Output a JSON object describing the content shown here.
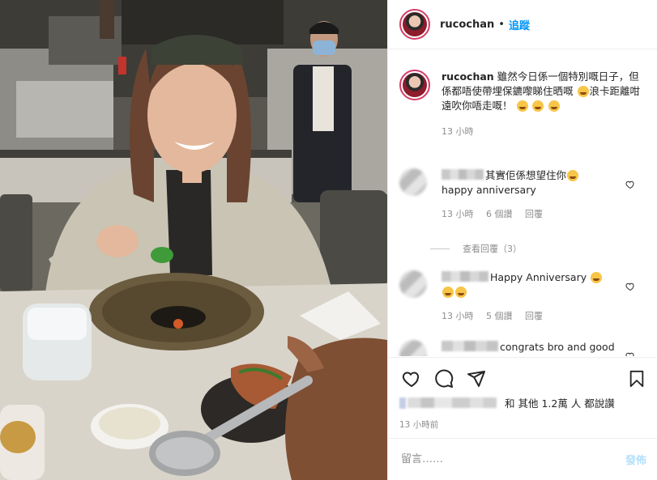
{
  "post": {
    "username": "rucochan",
    "follow_label": "追蹤",
    "separator": "•",
    "caption": {
      "username": "rucochan",
      "text": "雖然今日係一個特別嘅日子，但係都唔使帶埋保鑣嚟睇住晒嘅",
      "text_after_emoji": "浪卡距離咁遠吹你唔走嘅！",
      "time": "13 小時",
      "emoji": [
        "grinning-sweat-emoji",
        "rolling-laugh-emoji",
        "rolling-laugh-emoji",
        "rolling-laugh-emoji"
      ]
    },
    "comments": [
      {
        "text": "其實佢係想望住你",
        "line2": "happy anniversary",
        "time": "13 小時",
        "likes": "6 個讚",
        "reply": "回覆",
        "view_replies": "查看回覆（3）"
      },
      {
        "text": "Happy Anniversary",
        "time": "13 小時",
        "likes": "5 個讚",
        "reply": "回覆"
      },
      {
        "text": "congrats bro and good"
      }
    ],
    "likes_text": "和 其他 1.2萬 人 都說讚",
    "posted_ago": "13 小時前",
    "comment_placeholder": "留言……",
    "post_label": "發佈"
  },
  "icons": {
    "like": "heart-icon",
    "comment": "comment-bubble-icon",
    "share": "paper-plane-icon",
    "save": "bookmark-icon"
  },
  "colors": {
    "link_blue": "#0095f6",
    "story_ring": "#d43d6a",
    "post_disabled": "#b2dffc",
    "muted": "#8e8e8e"
  }
}
